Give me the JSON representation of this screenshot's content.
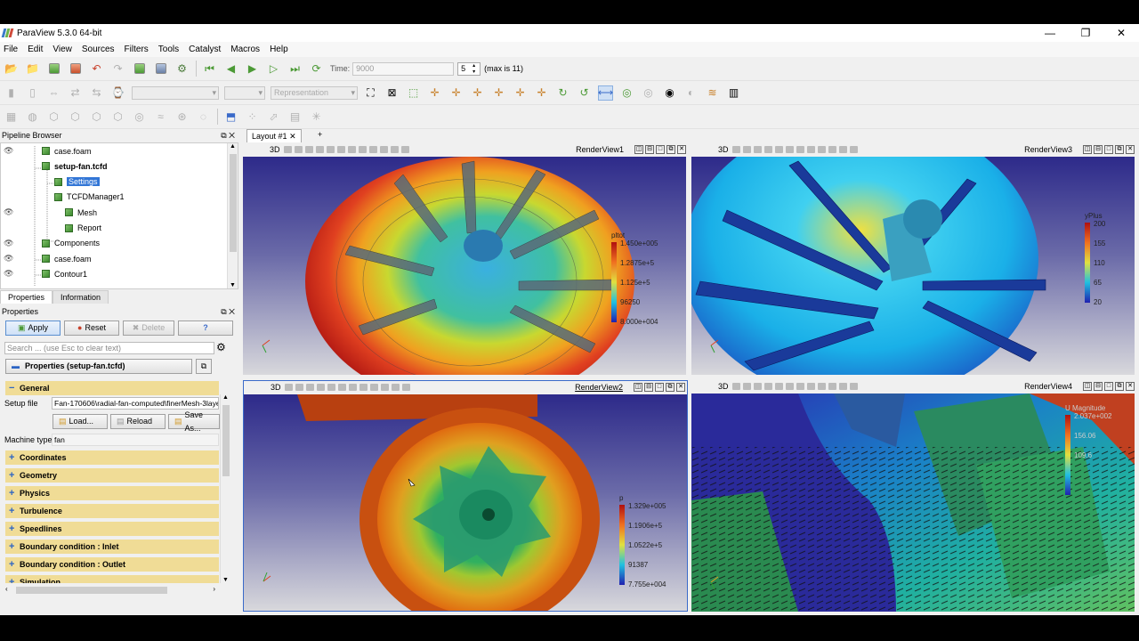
{
  "window": {
    "title": "ParaView 5.3.0 64-bit",
    "minimize": "—",
    "maximize": "❐",
    "close": "✕"
  },
  "menu": [
    "File",
    "Edit",
    "View",
    "Sources",
    "Filters",
    "Tools",
    "Catalyst",
    "Macros",
    "Help"
  ],
  "time": {
    "label": "Time:",
    "value": "9000",
    "step": "5",
    "max_text": "(max is 11)"
  },
  "representation": "Representation",
  "pipeline": {
    "title": "Pipeline Browser",
    "items": [
      {
        "label": "case.foam",
        "eye": true,
        "bold": false,
        "selected": false
      },
      {
        "label": "setup-fan.tcfd",
        "eye": false,
        "bold": true,
        "selected": false
      },
      {
        "label": "Settings",
        "eye": false,
        "bold": false,
        "selected": true
      },
      {
        "label": "TCFDManager1",
        "eye": false,
        "bold": false,
        "selected": false
      },
      {
        "label": "Mesh",
        "eye": true,
        "bold": false,
        "selected": false
      },
      {
        "label": "Report",
        "eye": false,
        "bold": false,
        "selected": false
      },
      {
        "label": "Components",
        "eye": true,
        "bold": false,
        "selected": false
      },
      {
        "label": "case.foam",
        "eye": true,
        "bold": false,
        "selected": false
      },
      {
        "label": "Contour1",
        "eye": true,
        "bold": false,
        "selected": false
      }
    ]
  },
  "tabs": {
    "properties": "Properties",
    "information": "Information"
  },
  "properties": {
    "title": "Properties",
    "apply": "Apply",
    "reset": "Reset",
    "delete": "Delete",
    "help": "?",
    "search_placeholder": "Search ... (use Esc to clear text)",
    "header": "Properties (setup-fan.tcfd)",
    "general": "General",
    "setup_file_label": "Setup file",
    "setup_file_value": "Fan-170606\\radial-fan-computed\\finerMesh-3laye",
    "load": "Load...",
    "reload": "Reload",
    "save_as": "Save As...",
    "machine_type_label": "Machine type",
    "machine_type_value": "fan",
    "groups": [
      "Coordinates",
      "Geometry",
      "Physics",
      "Turbulence",
      "Speedlines",
      "Boundary condition : Inlet",
      "Boundary condition : Outlet",
      "Simulation"
    ]
  },
  "layout": {
    "tab": "Layout #1",
    "add": "+"
  },
  "views": [
    {
      "name": "RenderView1",
      "active": false,
      "legend": {
        "title": "pltot",
        "labels": [
          "1.450e+005",
          "1.2875e+5",
          "1.125e+5",
          "96250",
          "8.000e+004"
        ]
      }
    },
    {
      "name": "RenderView3",
      "active": false,
      "legend": {
        "title": "yPlus",
        "labels": [
          "200",
          "155",
          "110",
          "65",
          "20"
        ]
      }
    },
    {
      "name": "RenderView2",
      "active": true,
      "legend": {
        "title": "p",
        "labels": [
          "1.329e+005",
          "1.1906e+5",
          "1.0522e+5",
          "91387",
          "7.755e+004"
        ]
      }
    },
    {
      "name": "RenderView4",
      "active": false,
      "legend": {
        "title": "U Magnitude",
        "labels": [
          "2.037e+002",
          "156.06",
          "109.6",
          "",
          ""
        ]
      }
    }
  ],
  "view_label_3d": "3D",
  "colors": {
    "selection": "#3276d6",
    "group_bg": "#f0dc96",
    "view_bg_top": "#2d2a8a",
    "view_bg_bottom": "#d8d8dc"
  }
}
